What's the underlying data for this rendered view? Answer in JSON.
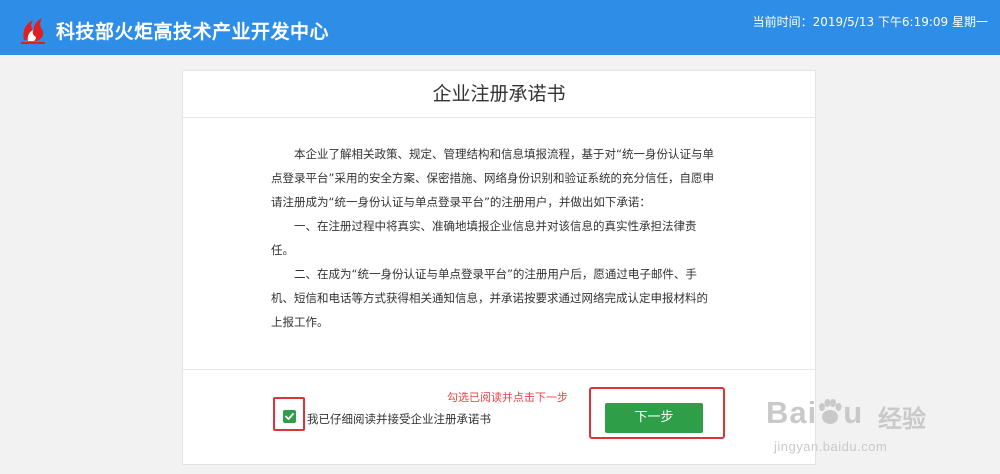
{
  "header": {
    "title": "科技部火炬高技术产业开发中心",
    "time_label": "当前时间：",
    "time_value": "2019/5/13 下午6:19:09 星期一",
    "colors": {
      "bar": "#2e8de6",
      "logo": "#e02020"
    },
    "logo_icon": "torch-logo-icon"
  },
  "card": {
    "title": "企业注册承诺书",
    "paragraphs": [
      "本企业了解相关政策、规定、管理结构和信息填报流程，基于对“统一身份认证与单点登录平台”采用的安全方案、保密措施、网络身份识别和验证系统的充分信任，自愿申请注册成为“统一身份认证与单点登录平台”的注册用户，并做出如下承诺：",
      "一、在注册过程中将真实、准确地填报企业信息并对该信息的真实性承担法律责任。",
      "二、在成为“统一身份认证与单点登录平台”的注册用户后，愿通过电子邮件、手机、短信和电话等方式获得相关通知信息，并承诺按要求通过网络完成认定申报材料的上报工作。"
    ]
  },
  "footer": {
    "hint": "勾选已阅读并点击下一步",
    "agree_label": "我已仔细阅读并接受企业注册承诺书",
    "agree_checked": true,
    "next_label": "下一步",
    "colors": {
      "button": "#2e9f48",
      "highlight": "#e0303a"
    }
  },
  "watermark": {
    "brand": "Bai",
    "brand_end": "u",
    "suffix": "经验",
    "url": "jingyan.baidu.com"
  }
}
